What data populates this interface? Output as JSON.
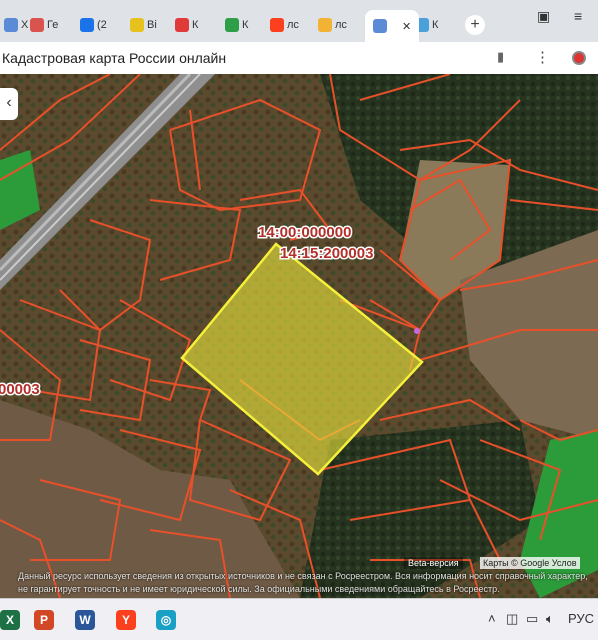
{
  "browser": {
    "tabs": [
      {
        "label": "X",
        "color": "#5b8bd6"
      },
      {
        "label": "Ге",
        "color": "#d9534f"
      },
      {
        "label": "(2",
        "color": "#1a73e8"
      },
      {
        "label": "Ві",
        "color": "#e6c31c"
      },
      {
        "label": "К",
        "color": "#e03a3a"
      },
      {
        "label": "К",
        "color": "#2e9e48"
      },
      {
        "label": "лс",
        "color": "#fc3f1d"
      },
      {
        "label": "лс",
        "color": "#f2b233"
      },
      {
        "label": "К",
        "color": "#4aa0d8"
      }
    ],
    "page_title": "Кадастровая карта России онлайн"
  },
  "map": {
    "label_quarter": "14:00:000000",
    "label_parcel": "14:15:200003",
    "label_left": "00003",
    "beta_label": "Beta-версия",
    "attribution": "Карты © Google  Услов",
    "disclaimer": "Данный ресурс использует сведения из открытых источников и не связан с Росреестром. Вся информация носит справочный характер, не гарантирует точность и не имеет юридической силы. За официальными сведениями обращайтесь в Росреестр.",
    "colors": {
      "parcel_border": "#e8502a",
      "selected_fill": "#e6e23a",
      "selected_border": "#f5f03a",
      "agri_field": "#2c9b3a"
    }
  },
  "taskbar": {
    "apps": [
      {
        "name": "excel",
        "label": "X",
        "color": "#1e7145"
      },
      {
        "name": "powerpoint",
        "label": "P",
        "color": "#d24726"
      },
      {
        "name": "word",
        "label": "W",
        "color": "#2b579a"
      },
      {
        "name": "yandex",
        "label": "Y",
        "color": "#fc3f1d"
      },
      {
        "name": "browser",
        "label": "◎",
        "color": "#1aa0c4"
      }
    ]
  }
}
